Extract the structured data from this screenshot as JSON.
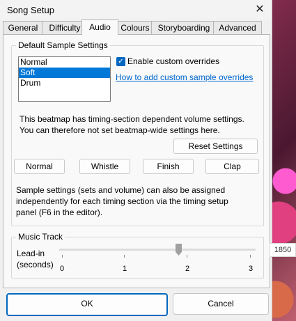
{
  "window": {
    "title": "Song Setup",
    "close_glyph": "✕"
  },
  "tabs": [
    {
      "label": "General"
    },
    {
      "label": "Difficulty"
    },
    {
      "label": "Audio"
    },
    {
      "label": "Colours"
    },
    {
      "label": "Storyboarding"
    },
    {
      "label": "Advanced"
    }
  ],
  "active_tab": "Audio",
  "sample_settings": {
    "group_label": "Default Sample Settings",
    "sample_sets": [
      "Normal",
      "Soft",
      "Drum"
    ],
    "selected_sample_set": "Soft",
    "custom_overrides_checked": true,
    "custom_overrides_label": "Enable custom overrides",
    "help_link": "How to add custom sample overrides",
    "notice_line1": "This beatmap has timing-section dependent volume settings.",
    "notice_line2": "You can therefore not set beatmap-wide settings here.",
    "reset_button": "Reset Settings",
    "hitsound_buttons": [
      "Normal",
      "Whistle",
      "Finish",
      "Clap"
    ],
    "info_line1": "Sample settings (sets and volume) can also be assigned",
    "info_line2": "independently for each timing section via the timing setup",
    "info_line3": "panel (F6 in the editor)."
  },
  "music_track": {
    "group_label": "Music Track",
    "lead_in_label_line1": "Lead-in",
    "lead_in_label_line2": "(seconds)",
    "slider_ticks": [
      "0",
      "1",
      "2",
      "3"
    ],
    "slider_value_fraction": 0.6,
    "value_display": "1850"
  },
  "footer": {
    "ok_label": "OK",
    "cancel_label": "Cancel"
  }
}
